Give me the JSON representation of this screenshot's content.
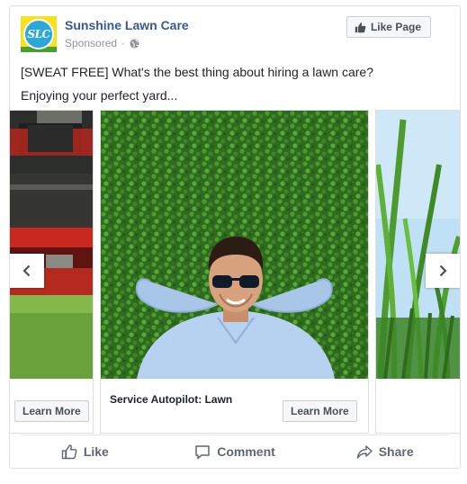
{
  "post": {
    "logo_text": "SLC",
    "page_name": "Sunshine Lawn Care",
    "sponsored": "Sponsored",
    "like_page_label": "Like Page",
    "body_line1": "[SWEAT FREE] What's the best thing about hiring a lawn care?",
    "body_line2": "Enjoying your perfect yard..."
  },
  "carousel": {
    "slides": [
      {
        "caption": "",
        "cta": "Learn More",
        "image": "lawn-mower-photo"
      },
      {
        "caption": "Service Autopilot: Lawn",
        "cta": "Learn More",
        "image": "man-lying-on-grass-photo"
      },
      {
        "caption": "",
        "cta": "",
        "image": "grass-blades-photo"
      }
    ],
    "prev_icon": "chevron-left-icon",
    "next_icon": "chevron-right-icon"
  },
  "actions": [
    {
      "label": "Like",
      "icon": "thumbs-up-icon"
    },
    {
      "label": "Comment",
      "icon": "comment-icon"
    },
    {
      "label": "Share",
      "icon": "share-icon"
    }
  ],
  "colors": {
    "link_blue": "#365899",
    "meta_gray": "#90949c",
    "button_bg": "#f6f7f9",
    "border": "#dddfe2"
  }
}
